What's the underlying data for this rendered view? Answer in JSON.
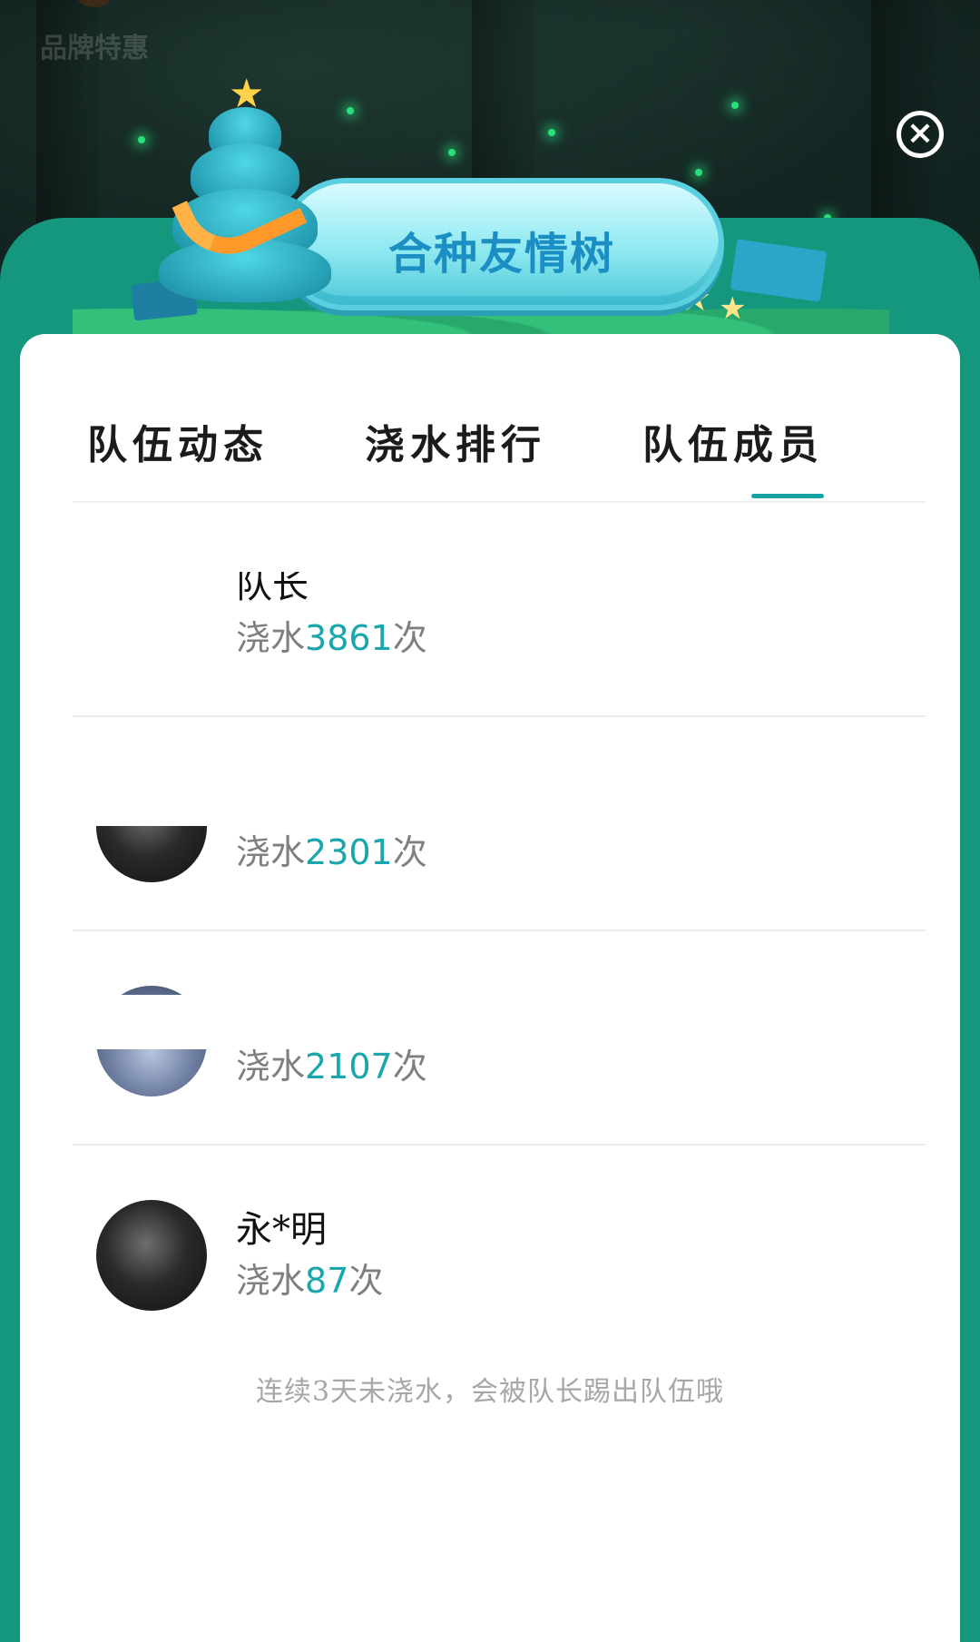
{
  "brand": {
    "label": "品牌特惠"
  },
  "close_icon": "close-icon",
  "title": "合种友情树",
  "tabs": [
    {
      "label": "队伍动态",
      "active": false
    },
    {
      "label": "浇水排行",
      "active": false
    },
    {
      "label": "队伍成员",
      "active": true
    }
  ],
  "members": [
    {
      "name": "队长",
      "water_prefix": "浇水",
      "water_count": "3861",
      "water_suffix": "次"
    },
    {
      "name": "",
      "water_prefix": "浇水",
      "water_count": "2301",
      "water_suffix": "次"
    },
    {
      "name": "",
      "water_prefix": "浇水",
      "water_count": "2107",
      "water_suffix": "次"
    },
    {
      "name": "永*明",
      "water_prefix": "浇水",
      "water_count": "87",
      "water_suffix": "次"
    }
  ],
  "footnote": "连续3天未浇水，会被队长踢出队伍哦",
  "colors": {
    "accent": "#19a7ad",
    "panel_green": "#15977d",
    "title_blue": "#1b8fc4"
  }
}
